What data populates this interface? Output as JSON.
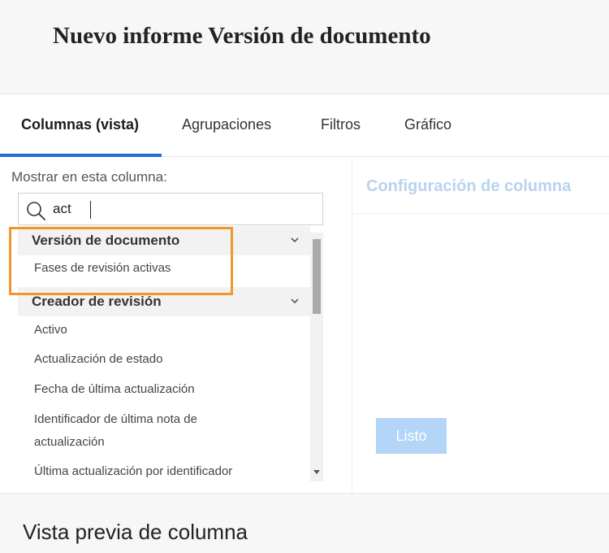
{
  "header": {
    "title": "Nuevo informe Versión de documento"
  },
  "tabs": [
    {
      "label": "Columnas (vista)",
      "active": true
    },
    {
      "label": "Agrupaciones",
      "active": false
    },
    {
      "label": "Filtros",
      "active": false
    },
    {
      "label": "Gráfico",
      "active": false
    }
  ],
  "left_panel": {
    "show_label": "Mostrar en esta columna:",
    "search": {
      "value": "act",
      "placeholder": ""
    },
    "groups": [
      {
        "label": "Versión de documento",
        "items": [
          "Fases de revisión activas"
        ]
      },
      {
        "label": "Creador de revisión",
        "items": [
          "Activo",
          "Actualización de estado",
          "Fecha de última actualización",
          "Identificador de última nota de",
          "actualización",
          "Última actualización por identificador"
        ]
      }
    ]
  },
  "right_panel": {
    "title": "Configuración de columna",
    "done_label": "Listo"
  },
  "preview": {
    "title": "Vista previa de columna"
  },
  "colors": {
    "accent": "#1f6fd1",
    "highlight": "#f0962b",
    "muted_title": "#b9d3ee",
    "button_disabled": "#b3d5f7"
  }
}
